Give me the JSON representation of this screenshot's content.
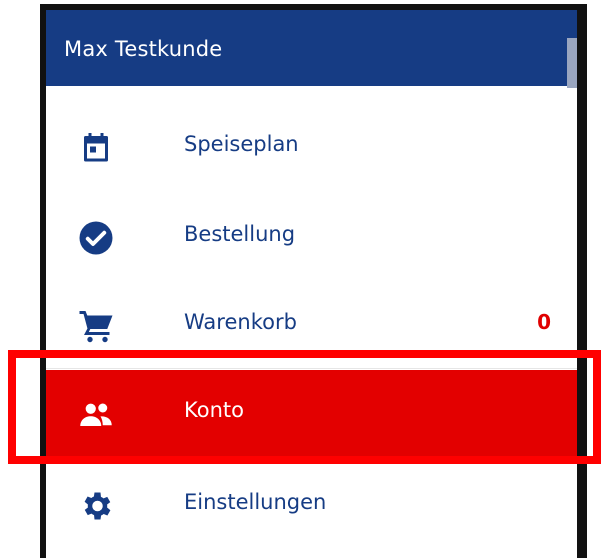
{
  "header": {
    "title": "Max Testkunde"
  },
  "menu": {
    "items": [
      {
        "label": "Speiseplan",
        "icon": "calendar-icon"
      },
      {
        "label": "Bestellung",
        "icon": "check-circle-icon"
      },
      {
        "label": "Warenkorb",
        "icon": "cart-icon",
        "badge": "0"
      },
      {
        "label": "Konto",
        "icon": "people-icon",
        "active": true
      },
      {
        "label": "Einstellungen",
        "icon": "gear-icon"
      }
    ]
  },
  "colors": {
    "header": "#163c84",
    "text": "#163c84",
    "active_bg": "#e30000",
    "badge": "#e00000",
    "highlight": "#ff0000"
  }
}
